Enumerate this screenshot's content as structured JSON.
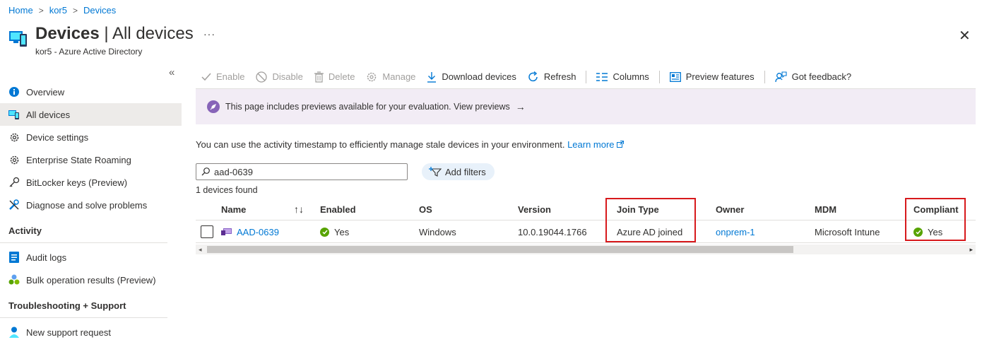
{
  "breadcrumb": [
    "Home",
    "kor5",
    "Devices"
  ],
  "header": {
    "title_main": "Devices",
    "title_rest": " | All devices",
    "subtitle": "kor5 - Azure Active Directory",
    "more": "···",
    "close": "✕"
  },
  "sidebar": {
    "items": [
      {
        "label": "Overview",
        "icon": "info-icon"
      },
      {
        "label": "All devices",
        "icon": "devices-icon",
        "active": true
      },
      {
        "label": "Device settings",
        "icon": "gear-icon"
      },
      {
        "label": "Enterprise State Roaming",
        "icon": "gear-icon"
      },
      {
        "label": "BitLocker keys (Preview)",
        "icon": "key-icon"
      },
      {
        "label": "Diagnose and solve problems",
        "icon": "wrench-icon"
      }
    ],
    "activity_title": "Activity",
    "activity_items": [
      {
        "label": "Audit logs",
        "icon": "log-icon"
      },
      {
        "label": "Bulk operation results (Preview)",
        "icon": "users-icon"
      }
    ],
    "support_title": "Troubleshooting + Support",
    "support_items": [
      {
        "label": "New support request",
        "icon": "person-icon"
      }
    ]
  },
  "toolbar": {
    "enable": "Enable",
    "disable": "Disable",
    "delete": "Delete",
    "manage": "Manage",
    "download": "Download devices",
    "refresh": "Refresh",
    "columns": "Columns",
    "preview": "Preview features",
    "feedback": "Got feedback?"
  },
  "banner": {
    "text": "This page includes previews available for your evaluation. View previews",
    "arrow": "→"
  },
  "info": {
    "text": "You can use the activity timestamp to efficiently manage stale devices in your environment. ",
    "link": "Learn more"
  },
  "search": {
    "value": "aad-0639"
  },
  "add_filters": "Add filters",
  "found_text": "1 devices found",
  "table": {
    "columns": [
      "Name",
      "Enabled",
      "OS",
      "Version",
      "Join Type",
      "Owner",
      "MDM",
      "Compliant"
    ],
    "rows": [
      {
        "name": "AAD-0639",
        "enabled": "Yes",
        "os": "Windows",
        "version": "10.0.19044.1766",
        "join_type": "Azure AD joined",
        "owner": "onprem-1",
        "mdm": "Microsoft Intune",
        "compliant": "Yes"
      }
    ]
  },
  "colors": {
    "accent": "#0078d4",
    "highlight": "#d7191c",
    "success": "#57a300",
    "banner_bg": "#f2ecf5",
    "preview_purple": "#8764b8"
  }
}
